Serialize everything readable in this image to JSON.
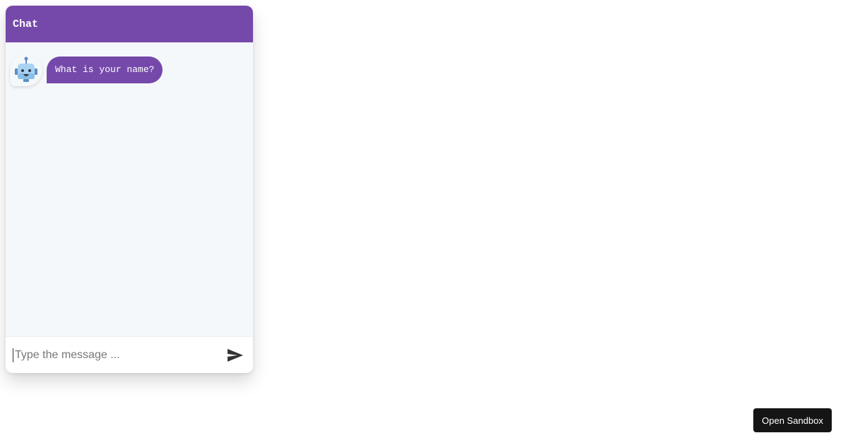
{
  "chat": {
    "title": "Chat",
    "messages": [
      {
        "sender": "bot",
        "avatar_icon": "robot-icon",
        "text": "What is your name?"
      }
    ],
    "input": {
      "value": "",
      "placeholder": "Type the message ..."
    },
    "send_icon": "send-icon"
  },
  "sandbox": {
    "label": "Open Sandbox"
  },
  "colors": {
    "accent": "#7549aa",
    "chat_background": "#f5f8fb",
    "sandbox_button": "#151515"
  }
}
